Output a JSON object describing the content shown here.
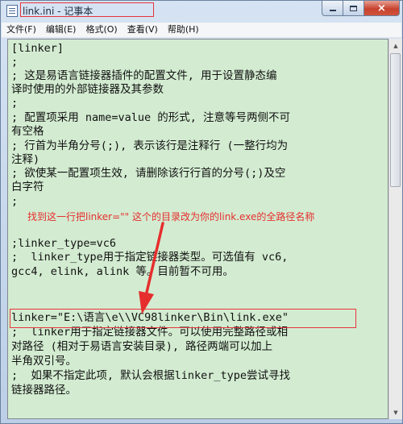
{
  "window": {
    "title": "link.ini - 记事本"
  },
  "caption": {
    "minimize": "minimize",
    "maximize": "maximize",
    "close": "×"
  },
  "menu": {
    "items": [
      {
        "label": "文件(F)"
      },
      {
        "label": "编辑(E)"
      },
      {
        "label": "格式(O)"
      },
      {
        "label": "查看(V)"
      },
      {
        "label": "帮助(H)"
      }
    ]
  },
  "editor": {
    "lines": [
      "[linker]",
      ";",
      "; 这是易语言链接器插件的配置文件, 用于设置静态编",
      "译时使用的外部链接器及其参数",
      ";",
      "; 配置项采用 name=value 的形式, 注意等号两侧不可",
      "有空格",
      "; 行首为半角分号(;), 表示该行是注释行 (一整行均为",
      "注释)",
      "; 欲使某一配置项生效, 请删除该行行首的分号(;)及空",
      "白字符",
      ";",
      "",
      "",
      ";linker_type=vc6",
      ";  linker_type用于指定链接器类型。可选值有 vc6,",
      "gcc4, elink, alink 等。目前暂不可用。",
      "",
      "",
      "linker=\"E:\\语言\\e\\\\VC98linker\\Bin\\link.exe\"",
      ";  linker用于指定链接器文件。可以使用完整路径或相",
      "对路径 (相对于易语言安装目录), 路径两端可以加上",
      "半角双引号。",
      ";  如果不指定此项, 默认会根据linker_type尝试寻找",
      "链接器路径。"
    ],
    "annotation": "找到这一行把linker=\"\" 这个的目录改为你的link.exe的全路径名称"
  },
  "icons": {
    "app": "notepad-icon",
    "arrow": "down-arrow-annotation"
  },
  "colors": {
    "editor_bg": "#d3ecd1",
    "annotation_red": "#e62e2e"
  }
}
